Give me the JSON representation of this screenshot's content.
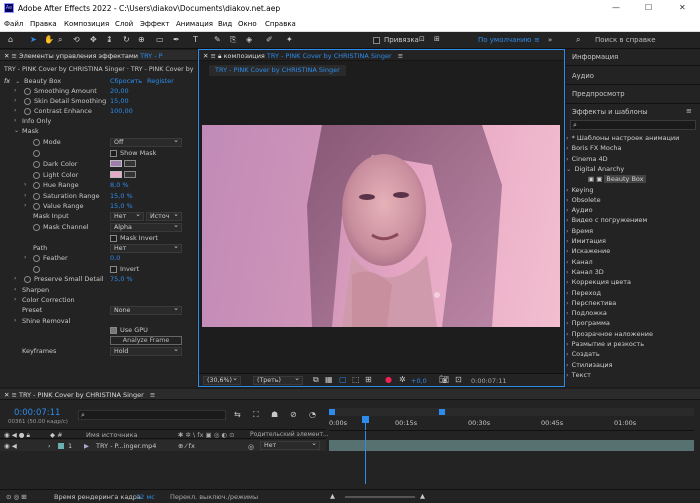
{
  "window": {
    "title": "Adobe After Effects 2022 - C:\\Users\\diakov\\Documents\\diakov.net.aep",
    "minimize": "—",
    "maximize": "☐",
    "close": "✕"
  },
  "menu": [
    "Файл",
    "Правка",
    "Композиция",
    "Слой",
    "Эффект",
    "Анимация",
    "Вид",
    "Окно",
    "Справка"
  ],
  "toolbar": {
    "snap_label": "Привязка",
    "workspace": "По умолчанию",
    "search_placeholder": "Поиск в справке"
  },
  "effects_panel": {
    "tab_title": "Элементы управления эффектами",
    "tab_layer": "TRY - P",
    "layer_path": "TRY - PINK Cover by  CHRISTINA Singer · TRY - PINK Cover by",
    "effect_name": "Beauty Box",
    "reset": "Сбросить",
    "register": "Register",
    "props": {
      "smoothing_amount": {
        "label": "Smoothing Amount",
        "value": "20,00"
      },
      "skin_detail": {
        "label": "Skin Detail Smoothing",
        "value": "15,00"
      },
      "contrast": {
        "label": "Contrast Enhance",
        "value": "100,00"
      },
      "info_only": "Info Only",
      "mask": "Mask",
      "mode": {
        "label": "Mode",
        "value": "Off"
      },
      "show_mask": "Show Mask",
      "dark_color": "Dark Color",
      "light_color": "Light Color",
      "hue_range": {
        "label": "Hue Range",
        "value": "8,0 %"
      },
      "saturation_range": {
        "label": "Saturation Range",
        "value": "15,0 %"
      },
      "value_range": {
        "label": "Value Range",
        "value": "15,0 %"
      },
      "mask_input": {
        "label": "Mask Input",
        "value1": "Нет",
        "value2": "Источ"
      },
      "mask_channel": {
        "label": "Mask Channel",
        "value": "Alpha"
      },
      "mask_invert": "Mask Invert",
      "path": {
        "label": "Path",
        "value": "Нет"
      },
      "feather": {
        "label": "Feather",
        "value": "0,0"
      },
      "invert": "Invert",
      "preserve_small": {
        "label": "Preserve Small Detail",
        "value": "75,0 %"
      },
      "sharpen": "Sharpen",
      "color_correction": "Color Correction",
      "preset": {
        "label": "Preset",
        "value": "None"
      },
      "shine_removal": "Shine Removal",
      "use_gpu": "Use GPU",
      "analyze_frame": "Analyze Frame",
      "keyframes": {
        "label": "Keyframes",
        "value": "Hold"
      }
    }
  },
  "composition": {
    "tab_prefix": "композиция",
    "tab_name": "TRY - PINK Cover by  CHRISTINA Singer",
    "sub_tab": "TRY - PINK Cover by  CHRISTINA Singer",
    "zoom": "(30,6%)",
    "resolution": "(Треть)",
    "exposure": "+0,0",
    "timecode": "0:00:07:11"
  },
  "right_panel": {
    "info": "Информация",
    "audio": "Аудио",
    "preview": "Предпросмотр",
    "effects_presets": "Эффекты и шаблоны",
    "search_placeholder": "",
    "items": [
      "* Шаблоны настроек анимации",
      "Boris FX Mocha",
      "Cinema 4D",
      "Digital Anarchy",
      "Keying",
      "Obsolete",
      "Аудио",
      "Видео с погружением",
      "Время",
      "Имитация",
      "Искажение",
      "Канал",
      "Канал 3D",
      "Коррекция цвета",
      "Переход",
      "Перспектива",
      "Подложка",
      "Программа",
      "Прозрачное наложение",
      "Размытие и резкость",
      "Создать",
      "Стилизация",
      "Текст"
    ],
    "sub_item": "Beauty Box"
  },
  "timeline": {
    "tab": "TRY - PINK Cover by  CHRISTINA Singer",
    "timecode": "0:00:07:11",
    "frame_info": "00361 (50.00 кадр/с)",
    "col_source": "Имя источника",
    "col_parent": "Родительский элемент...",
    "layer_num": "1",
    "layer_name": "TRY - P...inger.mp4",
    "layer_parent": "Нет",
    "ruler": [
      "0:00s",
      "00:15s",
      "00:30s",
      "00:45s",
      "01:00s"
    ],
    "render_label": "Время рендеринга кадра",
    "render_value": "12 мс",
    "toggle_label": "Перекл. выключ./режимы"
  },
  "colors": {
    "accent": "#2d8ceb",
    "dark_swatch": "#a07eab",
    "light_swatch": "#e8a9c8"
  }
}
